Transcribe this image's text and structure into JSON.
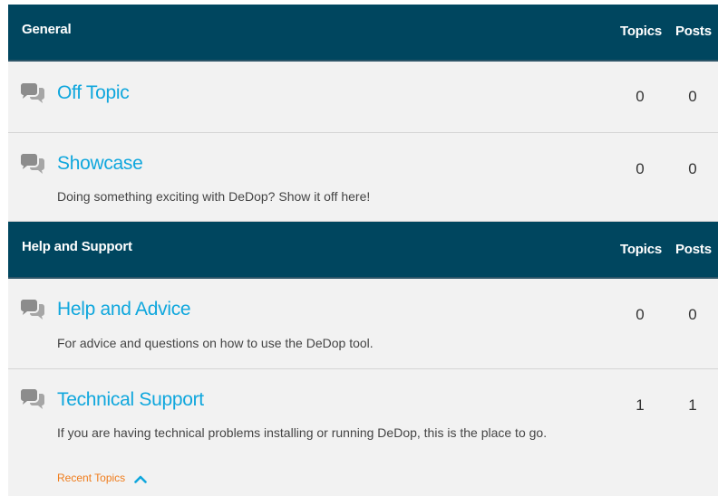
{
  "categories": [
    {
      "title": "General",
      "topics_label": "Topics",
      "posts_label": "Posts",
      "forums": [
        {
          "name": "Off Topic",
          "description": "",
          "topics": "0",
          "posts": "0"
        },
        {
          "name": "Showcase",
          "description": "Doing something exciting with DeDop? Show it off here!",
          "topics": "0",
          "posts": "0"
        }
      ]
    },
    {
      "title": "Help and Support",
      "topics_label": "Topics",
      "posts_label": "Posts",
      "forums": [
        {
          "name": "Help and Advice",
          "description": "For advice and questions on how to use the DeDop tool.",
          "topics": "0",
          "posts": "0"
        },
        {
          "name": "Technical Support",
          "description": "If you are having technical problems installing or running DeDop, this is the place to go.",
          "topics": "1",
          "posts": "1",
          "recent_topics_label": "Recent Topics"
        }
      ]
    }
  ],
  "icons": {
    "forum_icon": "chat-bubbles-icon",
    "recent_toggle_icon": "chevron-up-icon"
  },
  "colors": {
    "header_bg": "#00465f",
    "link": "#10a7dd",
    "recent": "#f07c1b",
    "row_bg": "#f2f2f2"
  }
}
